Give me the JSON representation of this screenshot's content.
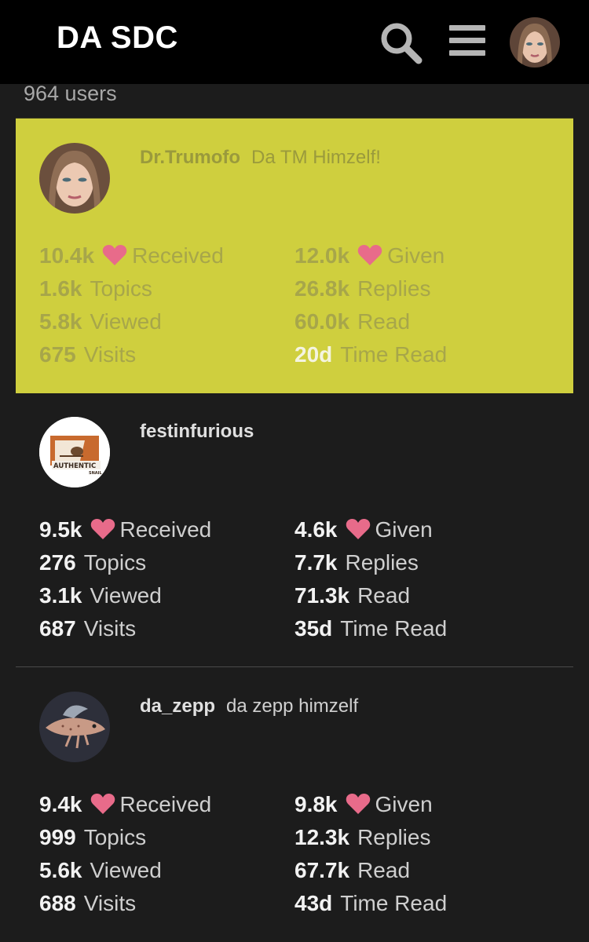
{
  "header": {
    "title": "DA SDC",
    "icons": [
      "search-icon",
      "hamburger-menu-icon",
      "current-user-avatar"
    ]
  },
  "user_count": "964 users",
  "colors": {
    "heart": "#e86b8a",
    "highlight_bg": "#cfcf3e",
    "page_bg": "#1c1c1c",
    "header_bg": "#000000"
  },
  "users": [
    {
      "username": "Dr.Trumofo",
      "title": "Da TM Himzelf!",
      "stats": {
        "received": {
          "num": "10.4k",
          "label": "Received"
        },
        "given": {
          "num": "12.0k",
          "label": "Given"
        },
        "topics": {
          "num": "1.6k",
          "label": "Topics"
        },
        "replies": {
          "num": "26.8k",
          "label": "Replies"
        },
        "viewed": {
          "num": "5.8k",
          "label": "Viewed"
        },
        "read": {
          "num": "60.0k",
          "label": "Read"
        },
        "visits": {
          "num": "675",
          "label": "Visits"
        },
        "time_read": {
          "num": "20d",
          "label": "Time Read"
        }
      }
    },
    {
      "username": "festinfurious",
      "title": "",
      "avatar_text": [
        "AUTHENTIC",
        "SNAIL"
      ],
      "stats": {
        "received": {
          "num": "9.5k",
          "label": "Received"
        },
        "given": {
          "num": "4.6k",
          "label": "Given"
        },
        "topics": {
          "num": "276",
          "label": "Topics"
        },
        "replies": {
          "num": "7.7k",
          "label": "Replies"
        },
        "viewed": {
          "num": "3.1k",
          "label": "Viewed"
        },
        "read": {
          "num": "71.3k",
          "label": "Read"
        },
        "visits": {
          "num": "687",
          "label": "Visits"
        },
        "time_read": {
          "num": "35d",
          "label": "Time Read"
        }
      }
    },
    {
      "username": "da_zepp",
      "title": "da zepp himzelf",
      "stats": {
        "received": {
          "num": "9.4k",
          "label": "Received"
        },
        "given": {
          "num": "9.8k",
          "label": "Given"
        },
        "topics": {
          "num": "999",
          "label": "Topics"
        },
        "replies": {
          "num": "12.3k",
          "label": "Replies"
        },
        "viewed": {
          "num": "5.6k",
          "label": "Viewed"
        },
        "read": {
          "num": "67.7k",
          "label": "Read"
        },
        "visits": {
          "num": "688",
          "label": "Visits"
        },
        "time_read": {
          "num": "43d",
          "label": "Time Read"
        }
      }
    }
  ]
}
